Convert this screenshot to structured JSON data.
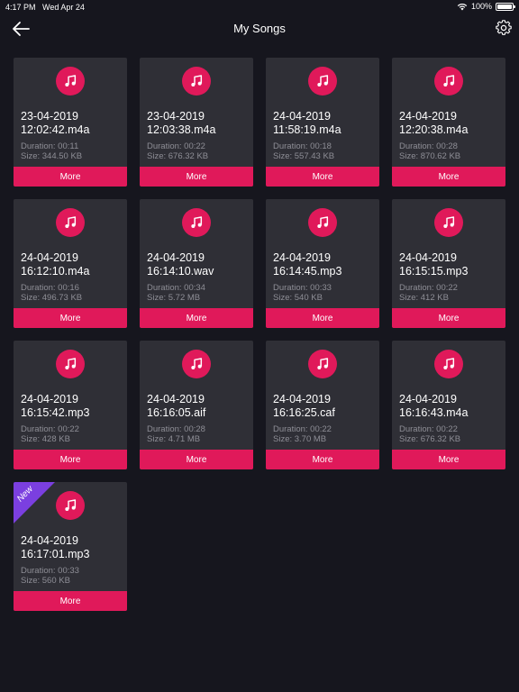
{
  "status_bar": {
    "time": "4:17 PM",
    "date": "Wed Apr 24",
    "battery": "100%",
    "icons": [
      "wifi-icon",
      "battery-icon"
    ]
  },
  "header": {
    "title": "My Songs",
    "back_icon": "arrow-left-icon",
    "settings_icon": "gear-icon"
  },
  "colors": {
    "background": "#16161e",
    "card": "#2f2f36",
    "accent": "#e0195a",
    "badge": "#7b3fe0",
    "meta_text": "#8e8e96"
  },
  "songs": [
    {
      "date": "23-04-2019",
      "file": "12:02:42.m4a",
      "duration": "Duration: 00:11",
      "size": "Size: 344.50 KB",
      "more": "More"
    },
    {
      "date": "23-04-2019",
      "file": "12:03:38.m4a",
      "duration": "Duration: 00:22",
      "size": "Size: 676.32 KB",
      "more": "More"
    },
    {
      "date": "24-04-2019",
      "file": "11:58:19.m4a",
      "duration": "Duration: 00:18",
      "size": "Size: 557.43 KB",
      "more": "More"
    },
    {
      "date": "24-04-2019",
      "file": "12:20:38.m4a",
      "duration": "Duration: 00:28",
      "size": "Size: 870.62 KB",
      "more": "More"
    },
    {
      "date": "24-04-2019",
      "file": "16:12:10.m4a",
      "duration": "Duration: 00:16",
      "size": "Size: 496.73 KB",
      "more": "More"
    },
    {
      "date": "24-04-2019",
      "file": "16:14:10.wav",
      "duration": "Duration: 00:34",
      "size": "Size: 5.72 MB",
      "more": "More"
    },
    {
      "date": "24-04-2019",
      "file": "16:14:45.mp3",
      "duration": "Duration: 00:33",
      "size": "Size: 540 KB",
      "more": "More"
    },
    {
      "date": "24-04-2019",
      "file": "16:15:15.mp3",
      "duration": "Duration: 00:22",
      "size": "Size: 412 KB",
      "more": "More"
    },
    {
      "date": "24-04-2019",
      "file": "16:15:42.mp3",
      "duration": "Duration: 00:22",
      "size": "Size: 428 KB",
      "more": "More"
    },
    {
      "date": "24-04-2019",
      "file": "16:16:05.aif",
      "duration": "Duration: 00:28",
      "size": "Size: 4.71 MB",
      "more": "More"
    },
    {
      "date": "24-04-2019",
      "file": "16:16:25.caf",
      "duration": "Duration: 00:22",
      "size": "Size: 3.70 MB",
      "more": "More"
    },
    {
      "date": "24-04-2019",
      "file": "16:16:43.m4a",
      "duration": "Duration: 00:22",
      "size": "Size: 676.32 KB",
      "more": "More"
    },
    {
      "date": "24-04-2019",
      "file": "16:17:01.mp3",
      "duration": "Duration: 00:33",
      "size": "Size: 560 KB",
      "more": "More",
      "badge": "New"
    }
  ]
}
